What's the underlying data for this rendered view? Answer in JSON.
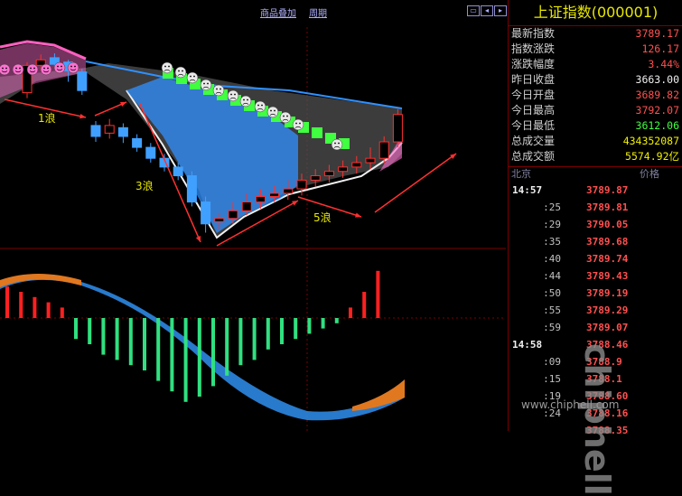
{
  "toolbar": {
    "overlay_label": "商品叠加",
    "period_label": "周期"
  },
  "panel": {
    "title": "上证指数(000001)",
    "quotes": [
      {
        "label": "最新指数",
        "value": "3789.17",
        "color": "red"
      },
      {
        "label": "指数涨跌",
        "value": "126.17",
        "color": "red"
      },
      {
        "label": "涨跌幅度",
        "value": "3.44%",
        "color": "red"
      },
      {
        "label": "昨日收盘",
        "value": "3663.00",
        "color": "white"
      },
      {
        "label": "今日开盘",
        "value": "3689.82",
        "color": "red"
      },
      {
        "label": "今日最高",
        "value": "3792.07",
        "color": "red"
      },
      {
        "label": "今日最低",
        "value": "3612.06",
        "color": "green"
      },
      {
        "label": "总成交量",
        "value": "434352087",
        "color": "yellow"
      },
      {
        "label": "总成交额",
        "value": "5574.92亿",
        "color": "yellow"
      }
    ],
    "tick_header": {
      "left": "北京",
      "right": "价格"
    },
    "ticks": [
      {
        "time": "14:57",
        "price": "3789.87",
        "major": true
      },
      {
        "time": ":25",
        "price": "3789.81",
        "major": false
      },
      {
        "time": ":29",
        "price": "3790.05",
        "major": false
      },
      {
        "time": ":35",
        "price": "3789.68",
        "major": false
      },
      {
        "time": ":40",
        "price": "3789.74",
        "major": false
      },
      {
        "time": ":44",
        "price": "3789.43",
        "major": false
      },
      {
        "time": ":50",
        "price": "3789.19",
        "major": false
      },
      {
        "time": ":55",
        "price": "3789.29",
        "major": false
      },
      {
        "time": ":59",
        "price": "3789.07",
        "major": false
      },
      {
        "time": "14:58",
        "price": "3788.46",
        "major": true
      },
      {
        "time": ":09",
        "price": "3788.9",
        "major": false
      },
      {
        "time": ":15",
        "price": "3788.1",
        "major": false
      },
      {
        "time": ":19",
        "price": "3788.60",
        "major": false
      },
      {
        "time": ":24",
        "price": "3788.16",
        "major": false
      },
      {
        "time": "",
        "price": "3788.35",
        "major": false
      }
    ]
  },
  "waves": {
    "wave1": "1浪",
    "wave3": "3浪",
    "wave5": "5浪"
  },
  "watermark": {
    "logo": "chiphell",
    "url": "www.chiphell.com"
  },
  "colors": {
    "up": "#ff3030",
    "down": "#40a0ff",
    "macd_up": "#ff2020",
    "macd_down": "#30e080",
    "bear_face": "#40ff40"
  },
  "chart_data": {
    "type": "candlestick",
    "candles": [
      {
        "open": 3740,
        "close": 3765,
        "high": 3768,
        "low": 3735
      },
      {
        "open": 3765,
        "close": 3770,
        "high": 3775,
        "low": 3760
      },
      {
        "open": 3772,
        "close": 3766,
        "high": 3776,
        "low": 3762
      },
      {
        "open": 3768,
        "close": 3760,
        "high": 3770,
        "low": 3750
      },
      {
        "open": 3759,
        "close": 3742,
        "high": 3762,
        "low": 3738
      },
      {
        "open": 3710,
        "close": 3700,
        "high": 3714,
        "low": 3695
      },
      {
        "open": 3703,
        "close": 3710,
        "high": 3716,
        "low": 3698
      },
      {
        "open": 3708,
        "close": 3700,
        "high": 3712,
        "low": 3694
      },
      {
        "open": 3698,
        "close": 3690,
        "high": 3702,
        "low": 3686
      },
      {
        "open": 3690,
        "close": 3680,
        "high": 3694,
        "low": 3676
      },
      {
        "open": 3680,
        "close": 3672,
        "high": 3684,
        "low": 3668
      },
      {
        "open": 3672,
        "close": 3664,
        "high": 3676,
        "low": 3660
      },
      {
        "open": 3664,
        "close": 3640,
        "high": 3668,
        "low": 3636
      },
      {
        "open": 3640,
        "close": 3620,
        "high": 3645,
        "low": 3612
      },
      {
        "open": 3622,
        "close": 3625,
        "high": 3630,
        "low": 3615
      },
      {
        "open": 3625,
        "close": 3632,
        "high": 3640,
        "low": 3620
      },
      {
        "open": 3632,
        "close": 3640,
        "high": 3648,
        "low": 3628
      },
      {
        "open": 3640,
        "close": 3645,
        "high": 3652,
        "low": 3634
      },
      {
        "open": 3645,
        "close": 3648,
        "high": 3655,
        "low": 3640
      },
      {
        "open": 3648,
        "close": 3652,
        "high": 3660,
        "low": 3642
      },
      {
        "open": 3652,
        "close": 3660,
        "high": 3666,
        "low": 3646
      },
      {
        "open": 3660,
        "close": 3664,
        "high": 3670,
        "low": 3654
      },
      {
        "open": 3664,
        "close": 3668,
        "high": 3674,
        "low": 3658
      },
      {
        "open": 3668,
        "close": 3672,
        "high": 3678,
        "low": 3662
      },
      {
        "open": 3672,
        "close": 3676,
        "high": 3682,
        "low": 3666
      },
      {
        "open": 3676,
        "close": 3680,
        "high": 3690,
        "low": 3670
      },
      {
        "open": 3680,
        "close": 3695,
        "high": 3700,
        "low": 3675
      },
      {
        "open": 3695,
        "close": 3720,
        "high": 3725,
        "low": 3690
      }
    ],
    "macd": [
      0.6,
      0.5,
      0.4,
      0.3,
      0.2,
      -0.4,
      -0.5,
      -0.7,
      -0.8,
      -0.9,
      -1.0,
      -1.2,
      -1.4,
      -1.6,
      -1.5,
      -1.3,
      -1.1,
      -0.9,
      -0.8,
      -0.6,
      -0.5,
      -0.4,
      -0.3,
      -0.2,
      -0.1,
      0.2,
      0.5,
      0.9
    ],
    "ylim": [
      3600,
      3800
    ]
  }
}
